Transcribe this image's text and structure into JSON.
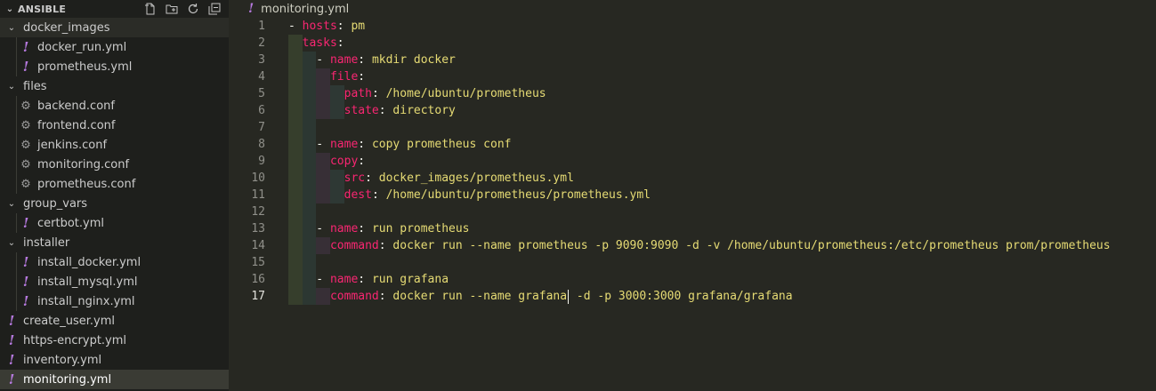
{
  "sidebar": {
    "title": "ANSIBLE",
    "header_actions": [
      "new-file-icon",
      "new-folder-icon",
      "refresh-icon",
      "collapse-all-icon"
    ],
    "items": [
      {
        "label": "docker_images",
        "type": "folder",
        "depth": 0,
        "expanded": true
      },
      {
        "label": "docker_run.yml",
        "type": "yml",
        "depth": 1
      },
      {
        "label": "prometheus.yml",
        "type": "yml",
        "depth": 1
      },
      {
        "label": "files",
        "type": "folder",
        "depth": 0,
        "expanded": true
      },
      {
        "label": "backend.conf",
        "type": "conf",
        "depth": 1
      },
      {
        "label": "frontend.conf",
        "type": "conf",
        "depth": 1
      },
      {
        "label": "jenkins.conf",
        "type": "conf",
        "depth": 1
      },
      {
        "label": "monitoring.conf",
        "type": "conf",
        "depth": 1
      },
      {
        "label": "prometheus.conf",
        "type": "conf",
        "depth": 1
      },
      {
        "label": "group_vars",
        "type": "folder",
        "depth": 0,
        "expanded": true
      },
      {
        "label": "certbot.yml",
        "type": "yml",
        "depth": 1
      },
      {
        "label": "installer",
        "type": "folder",
        "depth": 0,
        "expanded": true
      },
      {
        "label": "install_docker.yml",
        "type": "yml",
        "depth": 1
      },
      {
        "label": "install_mysql.yml",
        "type": "yml",
        "depth": 1
      },
      {
        "label": "install_nginx.yml",
        "type": "yml",
        "depth": 1
      },
      {
        "label": "create_user.yml",
        "type": "yml",
        "depth": 0
      },
      {
        "label": "https-encrypt.yml",
        "type": "yml",
        "depth": 0
      },
      {
        "label": "inventory.yml",
        "type": "yml",
        "depth": 0
      },
      {
        "label": "monitoring.yml",
        "type": "yml",
        "depth": 0,
        "selected": true
      }
    ]
  },
  "editor": {
    "tab_label": "monitoring.yml",
    "active_line": 17,
    "lines": [
      [
        {
          "t": "- ",
          "c": "p"
        },
        {
          "t": "hosts",
          "c": "k"
        },
        {
          "t": ": ",
          "c": "p"
        },
        {
          "t": "pm",
          "c": "s"
        }
      ],
      [
        {
          "t": "  ",
          "c": "p"
        },
        {
          "t": "tasks",
          "c": "k"
        },
        {
          "t": ":",
          "c": "p"
        }
      ],
      [
        {
          "t": "    - ",
          "c": "p"
        },
        {
          "t": "name",
          "c": "k"
        },
        {
          "t": ": ",
          "c": "p"
        },
        {
          "t": "mkdir docker",
          "c": "s"
        }
      ],
      [
        {
          "t": "      ",
          "c": "p"
        },
        {
          "t": "file",
          "c": "k"
        },
        {
          "t": ":",
          "c": "p"
        }
      ],
      [
        {
          "t": "        ",
          "c": "p"
        },
        {
          "t": "path",
          "c": "k"
        },
        {
          "t": ": ",
          "c": "p"
        },
        {
          "t": "/home/ubuntu/prometheus",
          "c": "s"
        }
      ],
      [
        {
          "t": "        ",
          "c": "p"
        },
        {
          "t": "state",
          "c": "k"
        },
        {
          "t": ": ",
          "c": "p"
        },
        {
          "t": "directory",
          "c": "s"
        }
      ],
      [],
      [
        {
          "t": "    - ",
          "c": "p"
        },
        {
          "t": "name",
          "c": "k"
        },
        {
          "t": ": ",
          "c": "p"
        },
        {
          "t": "copy prometheus conf",
          "c": "s"
        }
      ],
      [
        {
          "t": "      ",
          "c": "p"
        },
        {
          "t": "copy",
          "c": "k"
        },
        {
          "t": ":",
          "c": "p"
        }
      ],
      [
        {
          "t": "        ",
          "c": "p"
        },
        {
          "t": "src",
          "c": "k"
        },
        {
          "t": ": ",
          "c": "p"
        },
        {
          "t": "docker_images/prometheus.yml",
          "c": "s"
        }
      ],
      [
        {
          "t": "        ",
          "c": "p"
        },
        {
          "t": "dest",
          "c": "k"
        },
        {
          "t": ": ",
          "c": "p"
        },
        {
          "t": "/home/ubuntu/prometheus/prometheus.yml",
          "c": "s"
        }
      ],
      [],
      [
        {
          "t": "    - ",
          "c": "p"
        },
        {
          "t": "name",
          "c": "k"
        },
        {
          "t": ": ",
          "c": "p"
        },
        {
          "t": "run prometheus",
          "c": "s"
        }
      ],
      [
        {
          "t": "      ",
          "c": "p"
        },
        {
          "t": "command",
          "c": "k"
        },
        {
          "t": ": ",
          "c": "p"
        },
        {
          "t": "docker run --name prometheus -p 9090:9090 -d -v /home/ubuntu/prometheus:/etc/prometheus prom/prometheus",
          "c": "s"
        }
      ],
      [],
      [
        {
          "t": "    - ",
          "c": "p"
        },
        {
          "t": "name",
          "c": "k"
        },
        {
          "t": ": ",
          "c": "p"
        },
        {
          "t": "run grafana",
          "c": "s"
        }
      ],
      [
        {
          "t": "      ",
          "c": "p"
        },
        {
          "t": "command",
          "c": "k"
        },
        {
          "t": ": ",
          "c": "p"
        },
        {
          "t": "docker run --name grafana",
          "c": "s"
        },
        {
          "t": "|CURSOR|",
          "c": "cursor"
        },
        {
          "t": " -d -p 3000:3000 grafana/grafana",
          "c": "s"
        }
      ]
    ]
  },
  "colors": {
    "keyword": "#f92672",
    "string": "#e6db74",
    "yml_icon": "#b77ae0",
    "background": "#272822"
  }
}
